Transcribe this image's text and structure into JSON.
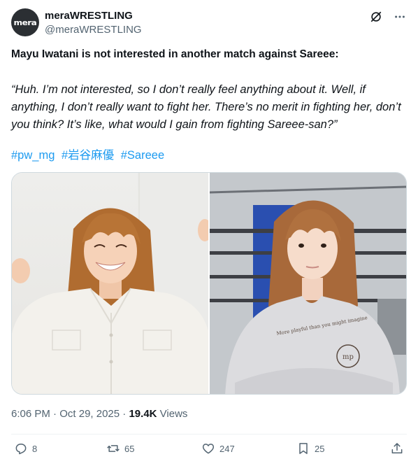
{
  "account": {
    "avatar_text": "mera",
    "display_name": "meraWRESTLING",
    "handle": "@meraWRESTLING"
  },
  "icons": {
    "grok": "grok-icon",
    "more": "more-icon",
    "reply": "reply-icon",
    "retweet": "retweet-icon",
    "like": "heart-icon",
    "bookmark": "bookmark-icon",
    "share": "share-icon"
  },
  "post": {
    "headline": "Mayu Iwatani is not interested in another match against Sareee:",
    "quote": "“Huh. I’m not interested, so I don’t really feel anything about it. Well, if anything, I don’t really want to fight her. There’s no merit in fighting her, don’t you think? It’s like, what would I gain from fighting Sareee-san?”",
    "hashtags": [
      "#pw_mg",
      "#岩谷麻優",
      "#Sareee"
    ]
  },
  "media": {
    "shirt_text": "More playful than you might imagine",
    "logo_text": "mp"
  },
  "meta": {
    "time": "6:06 PM",
    "separator": "·",
    "date": "Oct 29, 2025",
    "views_count": "19.4K",
    "views_label": "Views"
  },
  "actions": {
    "replies": "8",
    "reposts": "65",
    "likes": "247",
    "bookmarks": "25"
  },
  "colors": {
    "link": "#1d9bf0",
    "muted": "#536471",
    "text": "#0f1419"
  }
}
